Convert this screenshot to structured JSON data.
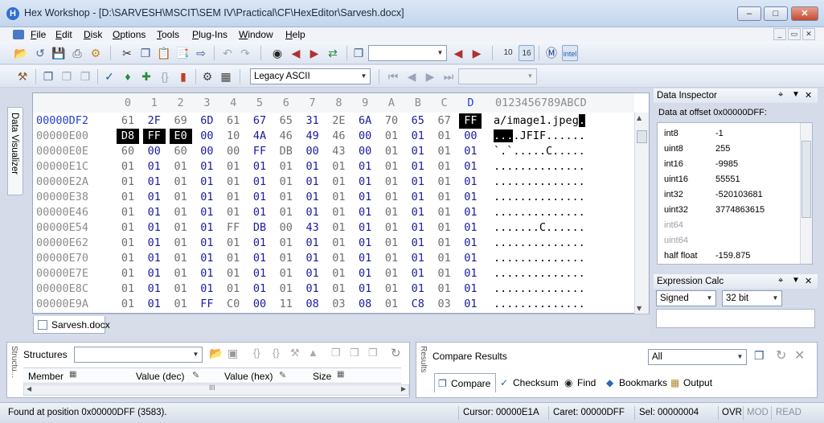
{
  "titlebar": {
    "title": "Hex Workshop - [D:\\SARVESH\\MSCIT\\SEM IV\\Practical\\CF\\HexEditor\\Sarvesh.docx]",
    "app_icon": "H"
  },
  "menubar": {
    "items": [
      "File",
      "Edit",
      "Disk",
      "Options",
      "Tools",
      "Plug-Ins",
      "Window",
      "Help"
    ]
  },
  "toolbar": {
    "charset_select": "Legacy ASCII",
    "search_combo": "",
    "goto_combo": ""
  },
  "left_tab": {
    "label": "Data Visualizer"
  },
  "editor": {
    "column_headers": [
      "0",
      "1",
      "2",
      "3",
      "4",
      "5",
      "6",
      "7",
      "8",
      "9",
      "A",
      "B",
      "C",
      "D"
    ],
    "ascii_header": "0123456789ABCD",
    "rows": [
      {
        "addr": "00000DF2",
        "bytes": [
          "61",
          "2F",
          "69",
          "6D",
          "61",
          "67",
          "65",
          "31",
          "2E",
          "6A",
          "70",
          "65",
          "67",
          "FF"
        ],
        "ascii": "a/image1.jpeg."
      },
      {
        "addr": "00000E00",
        "bytes": [
          "D8",
          "FF",
          "E0",
          "00",
          "10",
          "4A",
          "46",
          "49",
          "46",
          "00",
          "01",
          "01",
          "01",
          "00"
        ],
        "ascii": "....JFIF......"
      },
      {
        "addr": "00000E0E",
        "bytes": [
          "60",
          "00",
          "60",
          "00",
          "00",
          "FF",
          "DB",
          "00",
          "43",
          "00",
          "01",
          "01",
          "01",
          "01"
        ],
        "ascii": "`.`.....C....."
      },
      {
        "addr": "00000E1C",
        "bytes": [
          "01",
          "01",
          "01",
          "01",
          "01",
          "01",
          "01",
          "01",
          "01",
          "01",
          "01",
          "01",
          "01",
          "01"
        ],
        "ascii": ".............."
      },
      {
        "addr": "00000E2A",
        "bytes": [
          "01",
          "01",
          "01",
          "01",
          "01",
          "01",
          "01",
          "01",
          "01",
          "01",
          "01",
          "01",
          "01",
          "01"
        ],
        "ascii": ".............."
      },
      {
        "addr": "00000E38",
        "bytes": [
          "01",
          "01",
          "01",
          "01",
          "01",
          "01",
          "01",
          "01",
          "01",
          "01",
          "01",
          "01",
          "01",
          "01"
        ],
        "ascii": ".............."
      },
      {
        "addr": "00000E46",
        "bytes": [
          "01",
          "01",
          "01",
          "01",
          "01",
          "01",
          "01",
          "01",
          "01",
          "01",
          "01",
          "01",
          "01",
          "01"
        ],
        "ascii": ".............."
      },
      {
        "addr": "00000E54",
        "bytes": [
          "01",
          "01",
          "01",
          "01",
          "FF",
          "DB",
          "00",
          "43",
          "01",
          "01",
          "01",
          "01",
          "01",
          "01"
        ],
        "ascii": ".......C......"
      },
      {
        "addr": "00000E62",
        "bytes": [
          "01",
          "01",
          "01",
          "01",
          "01",
          "01",
          "01",
          "01",
          "01",
          "01",
          "01",
          "01",
          "01",
          "01"
        ],
        "ascii": ".............."
      },
      {
        "addr": "00000E70",
        "bytes": [
          "01",
          "01",
          "01",
          "01",
          "01",
          "01",
          "01",
          "01",
          "01",
          "01",
          "01",
          "01",
          "01",
          "01"
        ],
        "ascii": ".............."
      },
      {
        "addr": "00000E7E",
        "bytes": [
          "01",
          "01",
          "01",
          "01",
          "01",
          "01",
          "01",
          "01",
          "01",
          "01",
          "01",
          "01",
          "01",
          "01"
        ],
        "ascii": ".............."
      },
      {
        "addr": "00000E8C",
        "bytes": [
          "01",
          "01",
          "01",
          "01",
          "01",
          "01",
          "01",
          "01",
          "01",
          "01",
          "01",
          "01",
          "01",
          "01"
        ],
        "ascii": ".............."
      },
      {
        "addr": "00000E9A",
        "bytes": [
          "01",
          "01",
          "01",
          "FF",
          "C0",
          "00",
          "11",
          "08",
          "03",
          "08",
          "01",
          "C8",
          "03",
          "01"
        ],
        "ascii": ".............."
      }
    ],
    "colors": {
      "address": "#8c8c8c",
      "current_address": "#2540d0",
      "byte_blue": "#1a1aa0",
      "byte_grey": "#6e6e6e"
    }
  },
  "doc_tab": {
    "label": "Sarvesh.docx"
  },
  "data_inspector": {
    "title": "Data Inspector",
    "offset_label": "Data at offset 0x00000DFF:",
    "rows": [
      {
        "k": "int8",
        "v": "-1",
        "enabled": true
      },
      {
        "k": "uint8",
        "v": "255",
        "enabled": true
      },
      {
        "k": "int16",
        "v": "-9985",
        "enabled": true
      },
      {
        "k": "uint16",
        "v": "55551",
        "enabled": true
      },
      {
        "k": "int32",
        "v": "-520103681",
        "enabled": true
      },
      {
        "k": "uint32",
        "v": "3774863615",
        "enabled": true
      },
      {
        "k": "int64",
        "v": "",
        "enabled": false
      },
      {
        "k": "uint64",
        "v": "",
        "enabled": false
      },
      {
        "k": "half float",
        "v": "-159.875",
        "enabled": true
      }
    ]
  },
  "expression_calc": {
    "title": "Expression Calc",
    "sign_select": "Signed",
    "bits_select": "32 bit"
  },
  "structures": {
    "label": "Structures",
    "combo": "",
    "columns": [
      "Member",
      "Value (dec)",
      "Value (hex)",
      "Size"
    ],
    "side_label": "Structu..."
  },
  "compare": {
    "label": "Compare Results",
    "filter": "All",
    "side_label": "Results",
    "tabs": [
      "Compare",
      "Checksum",
      "Find",
      "Bookmarks",
      "Output"
    ]
  },
  "statusbar": {
    "message": "Found at position 0x00000DFF (3583).",
    "cursor": "Cursor: 00000E1A",
    "caret": "Caret: 00000DFF",
    "sel": "Sel: 00000004",
    "ovr": "OVR",
    "mod": "MOD",
    "read": "READ"
  }
}
